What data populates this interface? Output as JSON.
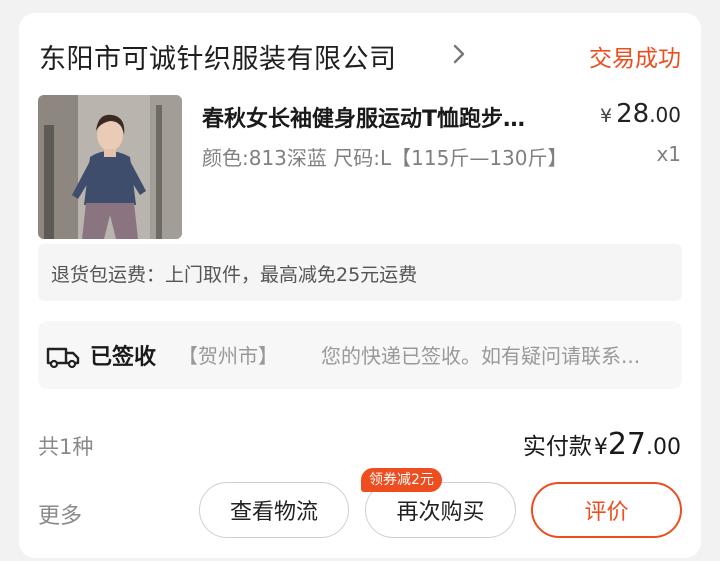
{
  "shop": {
    "name": "东阳市可诚针织服装有限公司",
    "status": "交易成功"
  },
  "product": {
    "title": "春秋女长袖健身服运动T恤跑步…",
    "price": {
      "currency": "¥",
      "integer": "28",
      "decimal": ".00"
    },
    "spec": "颜色:813深蓝 尺码:L【115斤—130斤】",
    "quantity": "x1"
  },
  "return_shipping": "退货包运费：上门取件，最高减免25元运费",
  "logistics": {
    "status": "已签收",
    "city": "【贺州市】",
    "message": "您的快递已签收。如有疑问请联系..."
  },
  "summary": {
    "count": "共1种",
    "paid_label": "实付款",
    "currency": "¥",
    "paid_integer": "27",
    "paid_decimal": ".00"
  },
  "actions": {
    "more": "更多",
    "view_logistics": "查看物流",
    "rebuy": "再次购买",
    "coupon_badge": "领券减2元",
    "review": "评价"
  },
  "colors": {
    "accent": "#ee4e1f",
    "shirt": "#3d4d6b",
    "leggings": "#8a7480"
  }
}
